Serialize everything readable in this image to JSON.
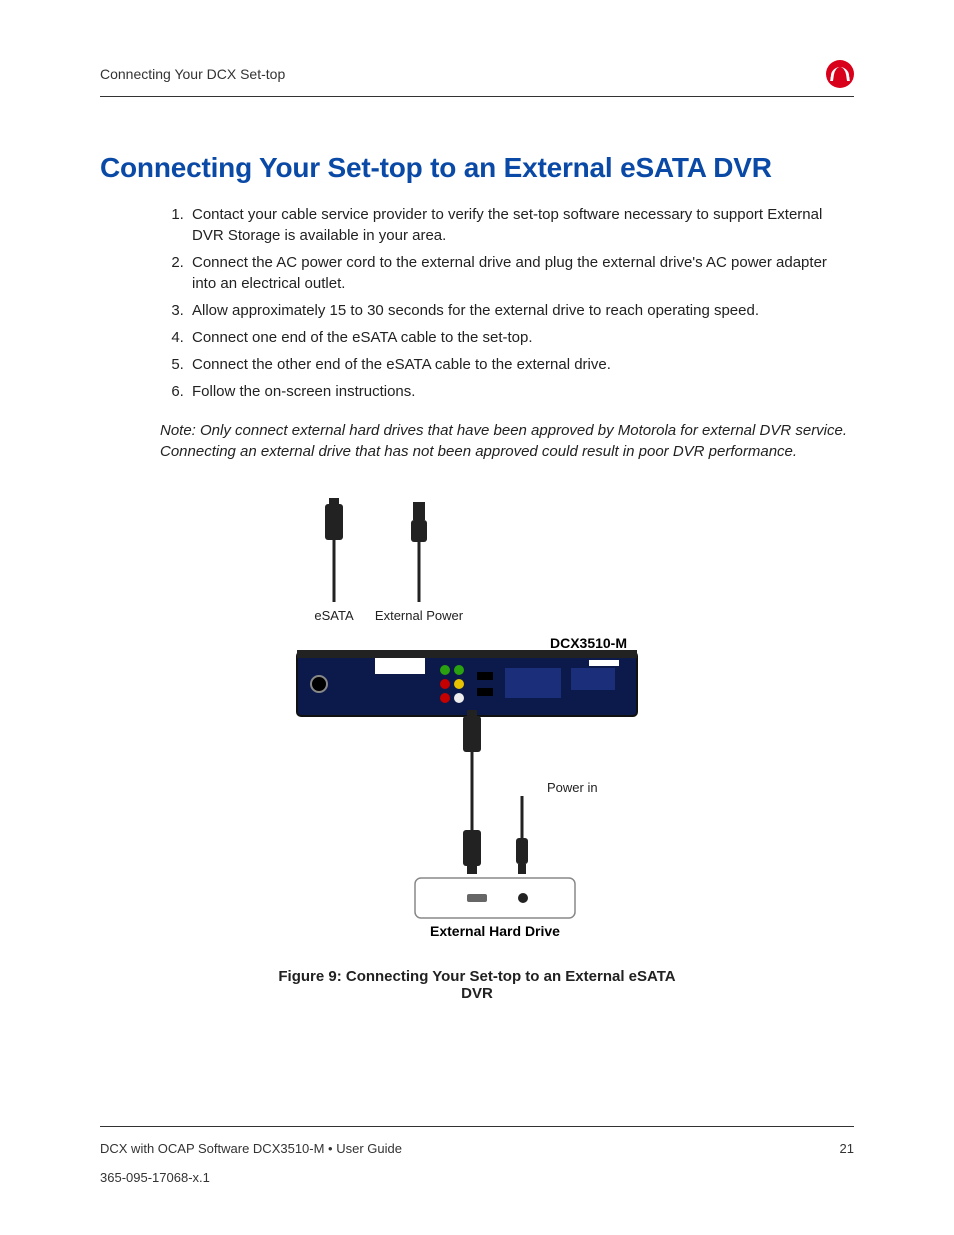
{
  "header": {
    "running_head": "Connecting Your DCX Set-top"
  },
  "section": {
    "title": "Connecting Your Set-top to an External eSATA DVR",
    "steps": [
      "Contact your cable service provider to verify the set-top software necessary to support External DVR Storage is available in your area.",
      "Connect the AC power cord to the external drive and plug the external drive's AC power adapter into an electrical outlet.",
      "Allow approximately 15 to 30 seconds for the external drive to reach operating speed.",
      "Connect one end of the eSATA cable to the set-top.",
      "Connect the other end of the eSATA cable to the external drive.",
      "Follow the on-screen instructions."
    ],
    "note": "Note: Only connect external hard drives that have been approved by Motorola for external DVR service. Connecting an external drive that has not been approved could result in poor DVR performance."
  },
  "diagram": {
    "labels": {
      "esata": "eSATA",
      "external_power": "External Power",
      "device_model": "DCX3510-M",
      "power_in": "Power in",
      "external_hard_drive": "External Hard Drive"
    },
    "caption": "Figure 9: Connecting Your Set-top to an External eSATA DVR"
  },
  "footer": {
    "product_line": "DCX with OCAP Software DCX3510-M • User Guide",
    "page_number": "21",
    "doc_number": "365-095-17068-x.1"
  }
}
